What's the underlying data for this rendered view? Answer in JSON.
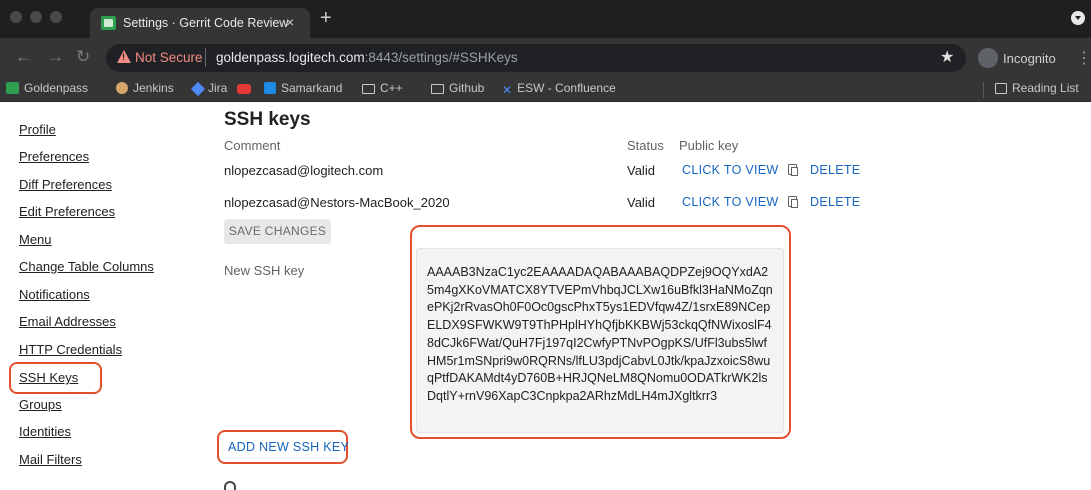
{
  "browser": {
    "tab_title": "Settings · Gerrit Code Review",
    "tab_close": "×",
    "new_tab": "+",
    "security_label": "Not Secure",
    "url_host": "goldenpass.logitech.com",
    "url_rest": ":8443/settings/#SSHKeys",
    "incognito_label": "Incognito",
    "bookmarks": [
      "Goldenpass",
      "Jenkins",
      "Jira",
      "Samarkand",
      "C++",
      "Github",
      "ESW - Confluence"
    ],
    "reading_list": "Reading List"
  },
  "sidebar": {
    "items": [
      "Profile",
      "Preferences",
      "Diff Preferences",
      "Edit Preferences",
      "Menu",
      "Change Table Columns",
      "Notifications",
      "Email Addresses",
      "HTTP Credentials",
      "SSH Keys",
      "Groups",
      "Identities",
      "Mail Filters"
    ],
    "active_item": "SSH Keys"
  },
  "ssh": {
    "title": "SSH keys",
    "headers": {
      "comment": "Comment",
      "status": "Status",
      "public_key": "Public key"
    },
    "keys": [
      {
        "comment": "nlopezcasad@logitech.com",
        "status": "Valid",
        "view_label": "CLICK TO VIEW",
        "delete_label": "DELETE"
      },
      {
        "comment": "nlopezcasad@Nestors-MacBook_2020",
        "status": "Valid",
        "view_label": "CLICK TO VIEW",
        "delete_label": "DELETE"
      }
    ],
    "save_label": "SAVE CHANGES",
    "new_key_label": "New SSH key",
    "new_key_value": "AAAAB3NzaC1yc2EAAAADAQABAAABAQDPZej9OQYxdA25m4gXKoVMATCX8YTVEPmVhbqJCLXw16uBfkl3HaNMoZqnePKj2rRvasOh0F0Oc0gscPhxT5ys1EDVfqw4Z/1srxE89NCepELDX9SFWKW9T9ThPHplHYhQfjbKKBWj53ckqQfNWixoslF48dCJk6FWat/QuH7Fj197qI2CwfyPTNvPOgpKS/UfFl3ubs5lwfHM5r1mSNpri9w0RQRNs/lfLU3pdjCabvL0Jtk/kpaJzxoicS8wuqPtfDAKAMdt4yD760B+HRJQNeLM8QNomu0ODATkrWK2lsDqtlY+rnV96XapC3Cnpkpa2ARhzMdLH4mJXgltkrr3",
    "add_label": "ADD NEW SSH KEY"
  },
  "colors": {
    "highlight": "#e2502f",
    "link": "#1565c0",
    "warning": "#f28b82"
  }
}
